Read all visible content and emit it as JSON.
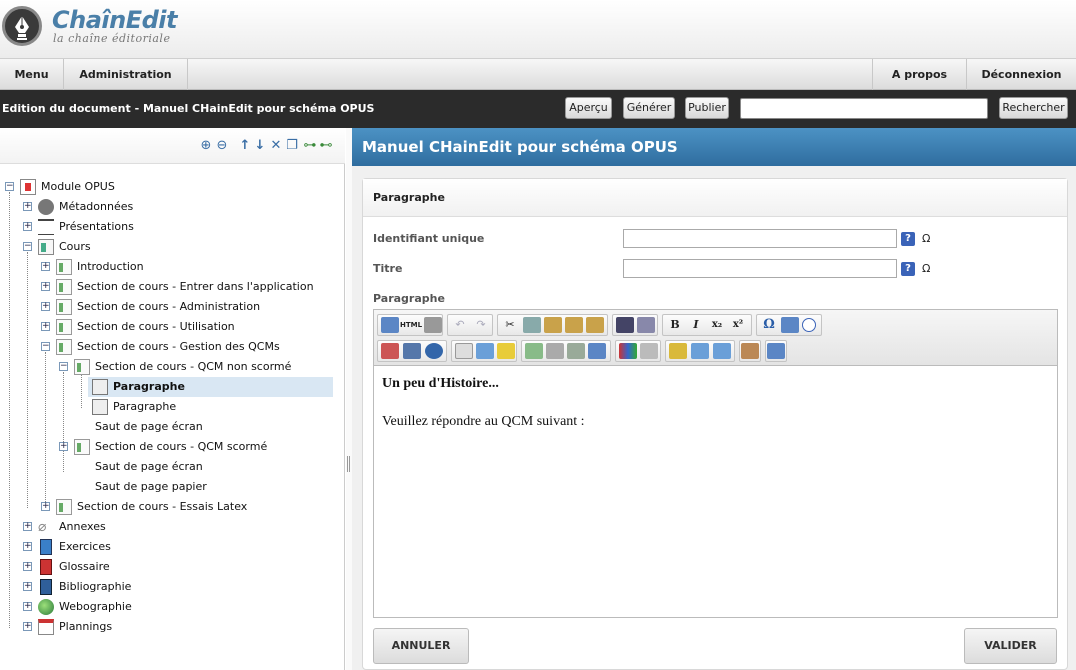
{
  "app": {
    "name": "ChaînEdit",
    "tagline": "la chaîne éditoriale",
    "brand_color": "#4a7fa8"
  },
  "menubar": {
    "menu": "Menu",
    "administration": "Administration",
    "about": "A propos",
    "logout": "Déconnexion"
  },
  "docbar": {
    "title": "Edition du document - Manuel CHainEdit pour schéma OPUS",
    "preview": "Aperçu",
    "generate": "Générer",
    "publish": "Publier",
    "search_value": "",
    "search": "Rechercher"
  },
  "tree_toolbar": {
    "icons": [
      "zoom-in-icon",
      "zoom-out-icon",
      "move-up-icon",
      "move-down-icon",
      "delete-icon",
      "copy-icon",
      "add-child-icon",
      "add-sibling-icon"
    ]
  },
  "tree": {
    "nodes": [
      {
        "label": "Module OPUS",
        "icon": "module-icon"
      },
      {
        "label": "Métadonnées",
        "icon": "metadata-icon"
      },
      {
        "label": "Présentations",
        "icon": "presentation-icon"
      },
      {
        "label": "Cours",
        "icon": "course-icon"
      },
      {
        "label": "Introduction",
        "icon": "document-icon"
      },
      {
        "label": "Section de cours - Entrer dans l'application",
        "icon": "document-icon"
      },
      {
        "label": "Section de cours - Administration",
        "icon": "document-icon"
      },
      {
        "label": "Section de cours - Utilisation",
        "icon": "document-icon"
      },
      {
        "label": "Section de cours - Gestion des QCMs",
        "icon": "document-icon"
      },
      {
        "label": "Section de cours - QCM non scormé",
        "icon": "document-icon"
      },
      {
        "label": "Paragraphe",
        "icon": "paragraph-icon"
      },
      {
        "label": "Paragraphe",
        "icon": "paragraph-icon"
      },
      {
        "label": "Saut de page écran",
        "icon": "page-break-icon"
      },
      {
        "label": "Section de cours - QCM scormé",
        "icon": "document-icon"
      },
      {
        "label": "Saut de page écran",
        "icon": "page-break-icon"
      },
      {
        "label": "Saut de page papier",
        "icon": "page-break-icon"
      },
      {
        "label": "Section de cours - Essais Latex",
        "icon": "document-icon"
      },
      {
        "label": "Annexes",
        "icon": "paperclip-icon"
      },
      {
        "label": "Exercices",
        "icon": "exercise-icon"
      },
      {
        "label": "Glossaire",
        "icon": "glossary-icon"
      },
      {
        "label": "Bibliographie",
        "icon": "book-icon"
      },
      {
        "label": "Webographie",
        "icon": "globe-icon"
      },
      {
        "label": "Plannings",
        "icon": "calendar-icon"
      }
    ],
    "selected": "Paragraphe"
  },
  "main": {
    "header": "Manuel CHainEdit pour schéma OPUS",
    "card_title": "Paragraphe",
    "fields": {
      "id_label": "Identifiant unique",
      "id_value": "",
      "title_label": "Titre",
      "title_value": "",
      "help": "?",
      "omega": "Ω",
      "para_label": "Paragraphe"
    },
    "editor": {
      "html_label": "HTML",
      "bold": "B",
      "italic": "I",
      "subscript": "x₂",
      "superscript": "x²",
      "omega": "Ω",
      "heading": "Un peu d'Histoire...",
      "body": "Veuillez répondre au QCM suivant :"
    },
    "cancel": "ANNULER",
    "validate": "VALIDER"
  },
  "colors": {
    "header_blue": "#3a7db0",
    "docbar_dark": "#2b2b2b",
    "selected_row": "#d9e7f3"
  }
}
